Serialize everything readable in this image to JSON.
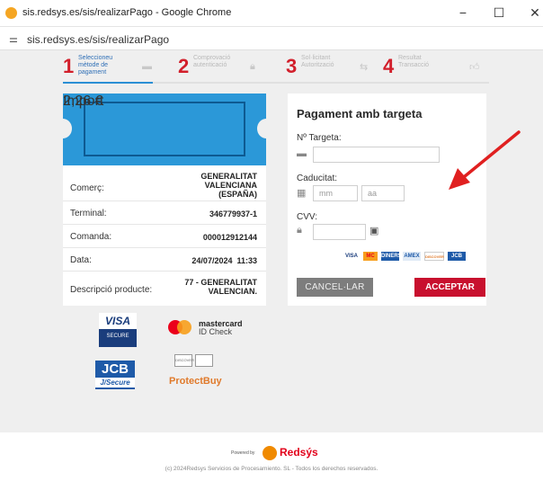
{
  "window": {
    "title": "sis.redsys.es/sis/realizarPago - Google Chrome",
    "minimize_glyph": "−",
    "maximize_glyph": "☐",
    "close_glyph": "✕"
  },
  "address_bar": {
    "url": "sis.redsys.es/sis/realizarPago"
  },
  "steps": [
    {
      "number": "1",
      "label": "Seleccioneu mètode de pagament",
      "icon": "card-icon",
      "active": true
    },
    {
      "number": "2",
      "label": "Comprovació autenticació",
      "icon": "lock-icon",
      "active": false
    },
    {
      "number": "3",
      "label": "Sol·licitant Autorització",
      "icon": "transfer-icon",
      "active": false
    },
    {
      "number": "4",
      "label": "Resultat Transacció",
      "icon": "thumbs-up-icon",
      "active": false
    }
  ],
  "ticket": {
    "label": "Import",
    "amount": "2,26 €"
  },
  "details": [
    {
      "key": "Comerç:",
      "value": "GENERALITAT\nVALENCIANA\n(ESPAÑA)"
    },
    {
      "key": "Terminal:",
      "value": "346779937-1"
    },
    {
      "key": "Comanda:",
      "value": "000012912144"
    },
    {
      "key": "Data:",
      "value": "24/07/2024  11:33"
    },
    {
      "key": "Descripció producte:",
      "value": "77 - GENERALITAT\nVALENCIAN."
    }
  ],
  "brand_logos": {
    "visa_main": "VISA",
    "visa_sub": "SECURE",
    "mastercard_main": "mastercard",
    "mastercard_sub": "ID Check",
    "jcb_main": "JCB",
    "jcb_sub": "J/Secure",
    "discover": "DISCOVER",
    "protectbuy": "ProtectBuy"
  },
  "card_form": {
    "title": "Pagament amb targeta",
    "card_number_label": "Nº Targeta:",
    "card_number_value": "",
    "expiry_label": "Caducitat:",
    "month_placeholder": "mm",
    "year_placeholder": "aa",
    "cvv_label": "CVV:",
    "cvv_value": "",
    "accepted_cards": [
      "VISA",
      "MC",
      "DINERS",
      "AMEX",
      "DISCOVER",
      "JCB"
    ],
    "cancel_label": "CANCEL·LAR",
    "accept_label": "ACCEPTAR"
  },
  "colors": {
    "accent_blue": "#2b98d8",
    "step_red": "#d21f2b",
    "accept_red": "#c8102e",
    "cancel_gray": "#7d7d7d",
    "annotation_arrow": "#e02020"
  },
  "footer": {
    "powered_by": "Powered by",
    "brand": "Redsýs",
    "copyright": "(c) 2024Redsys Servicios de Procesamiento. SL - Todos los derechos reservados."
  }
}
